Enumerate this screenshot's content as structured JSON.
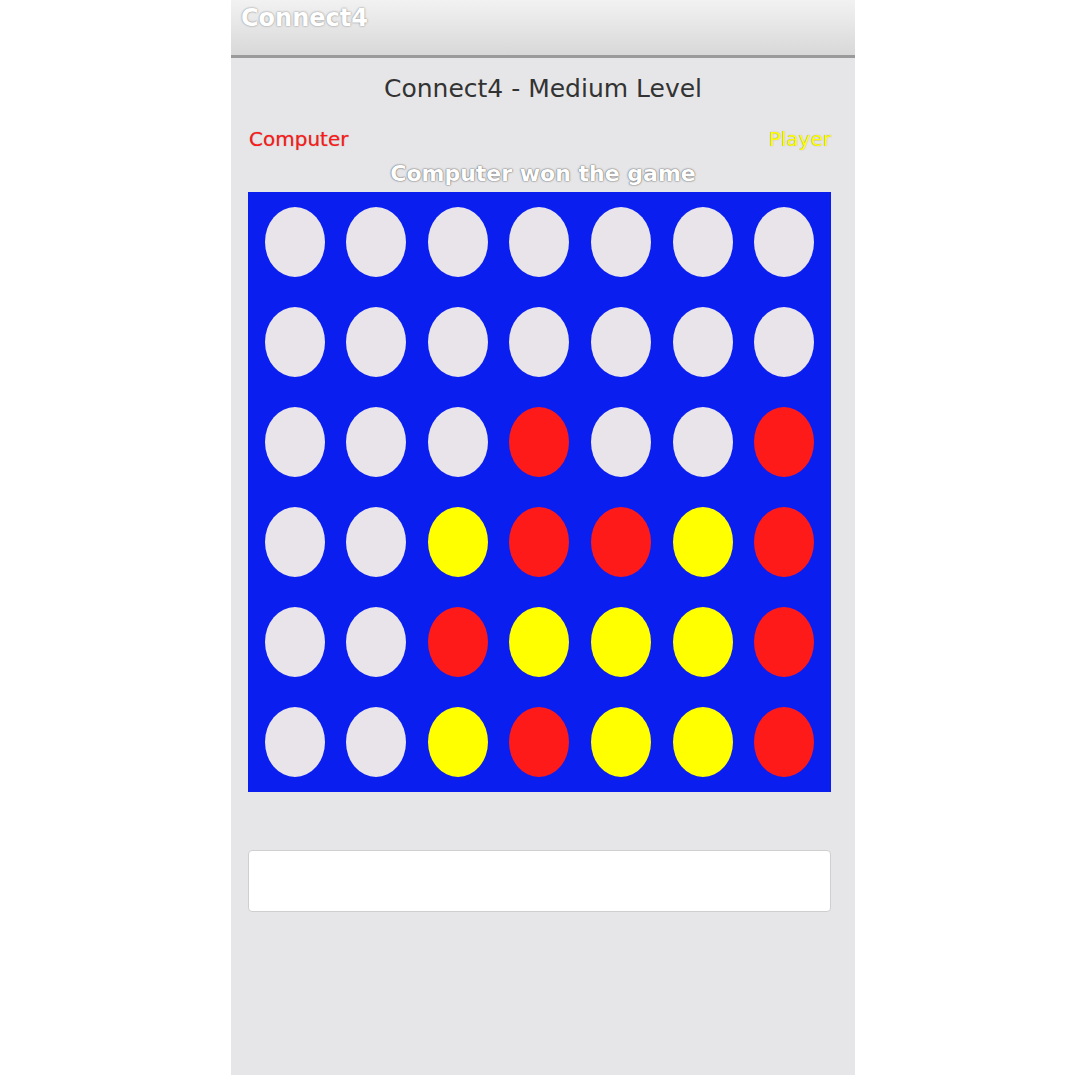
{
  "window": {
    "title": "Connect4"
  },
  "heading": "Connect4 - Medium Level",
  "players": [
    {
      "id": "computer",
      "name": "Computer",
      "color": "#ff1a1a"
    },
    {
      "id": "player",
      "name": "Player",
      "color": "#ffff00"
    }
  ],
  "status": "Computer won the game",
  "board": {
    "rows": [
      [
        "empty",
        "empty",
        "empty",
        "empty",
        "empty",
        "empty",
        "empty"
      ],
      [
        "empty",
        "empty",
        "empty",
        "empty",
        "empty",
        "empty",
        "empty"
      ],
      [
        "empty",
        "empty",
        "empty",
        "computer",
        "empty",
        "empty",
        "computer"
      ],
      [
        "empty",
        "empty",
        "player",
        "computer",
        "computer",
        "player",
        "computer"
      ],
      [
        "empty",
        "empty",
        "computer",
        "player",
        "player",
        "player",
        "computer"
      ],
      [
        "empty",
        "empty",
        "player",
        "computer",
        "player",
        "player",
        "computer"
      ]
    ]
  },
  "button": {
    "label": ""
  }
}
